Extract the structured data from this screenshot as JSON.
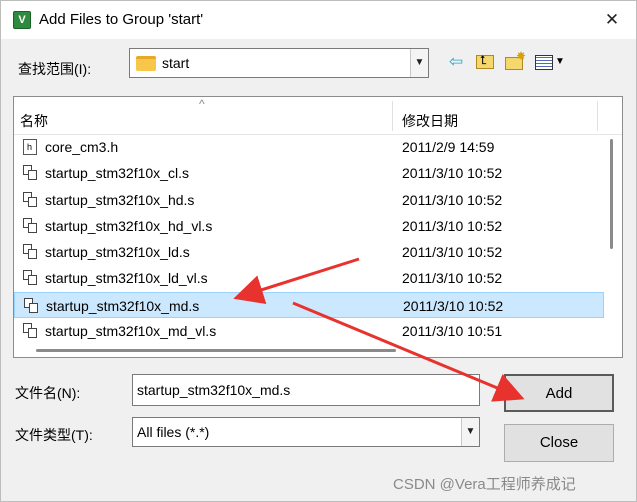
{
  "window": {
    "title": "Add Files to Group 'start'",
    "close_glyph": "✕"
  },
  "lookin": {
    "label": "查找范围(I):",
    "value": "start"
  },
  "toolbar": {
    "back_glyph": "⇦",
    "up_glyph": "⮤",
    "new_glyph": "✸",
    "view_dd_glyph": "▼"
  },
  "list": {
    "columns": {
      "name": "名称",
      "date": "修改日期",
      "sort_glyph": "^"
    },
    "rows": [
      {
        "name": "core_cm3.h",
        "date": "2011/2/9 14:59",
        "icon": "header-file-icon",
        "selected": false
      },
      {
        "name": "startup_stm32f10x_cl.s",
        "date": "2011/3/10 10:52",
        "icon": "asm-file-icon",
        "selected": false
      },
      {
        "name": "startup_stm32f10x_hd.s",
        "date": "2011/3/10 10:52",
        "icon": "asm-file-icon",
        "selected": false
      },
      {
        "name": "startup_stm32f10x_hd_vl.s",
        "date": "2011/3/10 10:52",
        "icon": "asm-file-icon",
        "selected": false
      },
      {
        "name": "startup_stm32f10x_ld.s",
        "date": "2011/3/10 10:52",
        "icon": "asm-file-icon",
        "selected": false
      },
      {
        "name": "startup_stm32f10x_ld_vl.s",
        "date": "2011/3/10 10:52",
        "icon": "asm-file-icon",
        "selected": false
      },
      {
        "name": "startup_stm32f10x_md.s",
        "date": "2011/3/10 10:52",
        "icon": "asm-file-icon",
        "selected": true
      },
      {
        "name": "startup_stm32f10x_md_vl.s",
        "date": "2011/3/10 10:51",
        "icon": "asm-file-icon",
        "selected": false
      }
    ]
  },
  "filename": {
    "label": "文件名(N):",
    "value": "startup_stm32f10x_md.s"
  },
  "filetype": {
    "label": "文件类型(T):",
    "value": "All files (*.*)"
  },
  "buttons": {
    "add": "Add",
    "close": "Close"
  },
  "watermark": "CSDN @Vera工程师养成记",
  "colors": {
    "selection": "#cce8ff",
    "annotation_arrow": "#e8322e"
  }
}
